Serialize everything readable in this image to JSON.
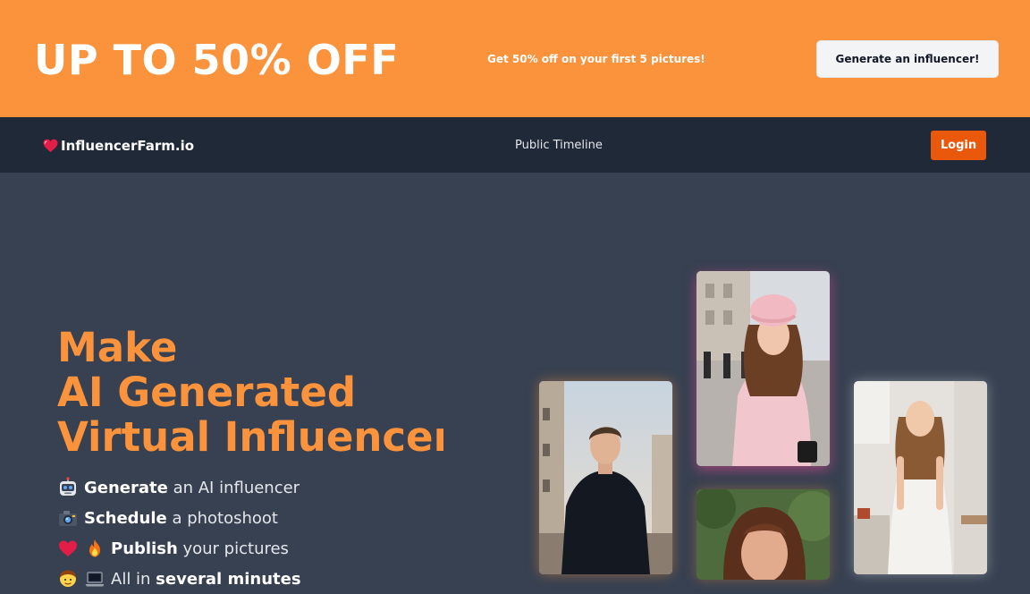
{
  "promo": {
    "headline": "UP TO 50% OFF",
    "subtext": "Get 50% off on your first 5 pictures!",
    "cta_label": "Generate an influencer!",
    "background": "#fb923c"
  },
  "nav": {
    "brand_icon": "heart-icon",
    "brand_name": "InfluencerFarm.io",
    "links": [
      {
        "label": "Public Timeline"
      }
    ],
    "login_label": "Login",
    "login_color": "#ea580c"
  },
  "hero": {
    "title_lines": [
      "Make",
      "AI Generated",
      "Virtual Influencers"
    ],
    "title_color": "#fb923c",
    "features": [
      {
        "icons": [
          "robot-icon"
        ],
        "bold": "Generate",
        "rest": " an AI influencer"
      },
      {
        "icons": [
          "camera-icon"
        ],
        "bold": "Schedule",
        "rest": " a photoshoot"
      },
      {
        "icons": [
          "heart-icon",
          "fire-icon"
        ],
        "bold": "Publish",
        "rest": " your pictures"
      },
      {
        "icons": [
          "person-icon",
          "laptop-icon"
        ],
        "prefix": "All in ",
        "bold": "several minutes",
        "rest": ""
      }
    ]
  },
  "gallery": [
    {
      "subject": "man in dark coat on city street"
    },
    {
      "subject": "woman in pink beret and pink coat"
    },
    {
      "subject": "woman with curly hair close-up"
    },
    {
      "subject": "woman in white dress in kitchen"
    }
  ]
}
